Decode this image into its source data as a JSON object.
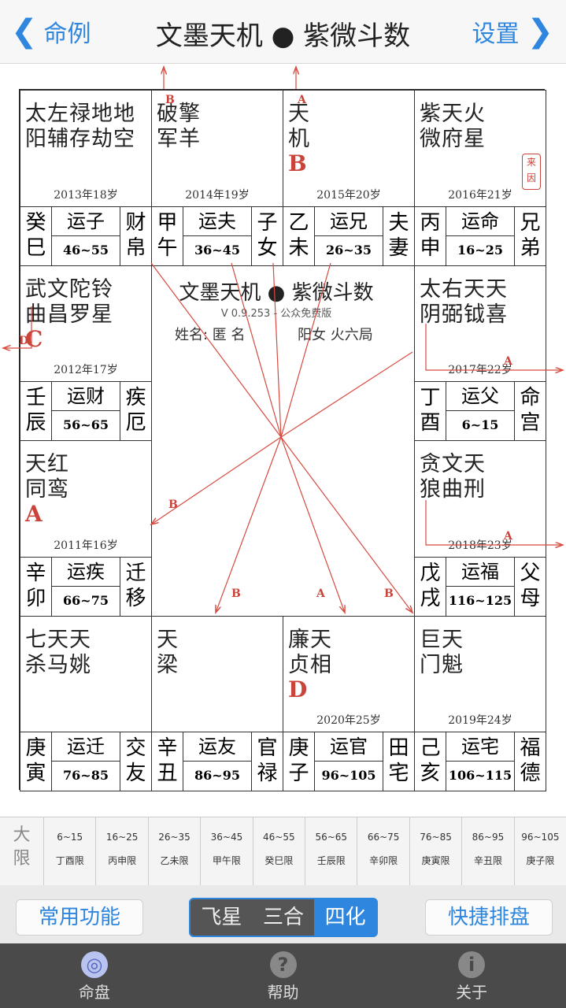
{
  "nav": {
    "back_label": "命例",
    "title": "文墨天机 ● 紫微斗数",
    "settings_label": "设置"
  },
  "palaces": [
    {
      "stars1": "太左禄地地",
      "stars2": "阳辅存劫空",
      "sihua": "",
      "age": "2013年18岁",
      "stem1": "癸",
      "stem2": "巳",
      "yun": "运子",
      "range": "46~55",
      "pal1": "财",
      "pal2": "帛"
    },
    {
      "stars1": "破擎",
      "stars2": "军羊",
      "sihua": "",
      "age": "2014年19岁",
      "stem1": "甲",
      "stem2": "午",
      "yun": "运夫",
      "range": "36~45",
      "pal1": "子",
      "pal2": "女"
    },
    {
      "stars1": "天",
      "stars2": "机",
      "sihua": "B",
      "age": "2015年20岁",
      "stem1": "乙",
      "stem2": "未",
      "yun": "运兄",
      "range": "26~35",
      "pal1": "夫",
      "pal2": "妻"
    },
    {
      "stars1": "紫天火",
      "stars2": "微府星",
      "sihua": "",
      "age": "2016年21岁",
      "stem1": "丙",
      "stem2": "申",
      "yun": "运命",
      "range": "16~25",
      "pal1": "兄",
      "pal2": "弟",
      "stamp": "来因"
    },
    {
      "stars1": "武文陀铃",
      "stars2": "曲昌罗星",
      "sihua": "C",
      "age": "2012年17岁",
      "stem1": "壬",
      "stem2": "辰",
      "yun": "运财",
      "range": "56~65",
      "pal1": "疾",
      "pal2": "厄"
    },
    {
      "stars1": "太右天天",
      "stars2": "阴弼钺喜",
      "sihua": "",
      "age": "2017年22岁",
      "stem1": "丁",
      "stem2": "酉",
      "yun": "运父",
      "range": "6~15",
      "pal1": "命",
      "pal2": "宫"
    },
    {
      "stars1": "天红",
      "stars2": "同鸾",
      "sihua": "A",
      "age": "2011年16岁",
      "stem1": "辛",
      "stem2": "卯",
      "yun": "运疾",
      "range": "66~75",
      "pal1": "迁",
      "pal2": "移"
    },
    {
      "stars1": "贪文天",
      "stars2": "狼曲刑",
      "sihua": "",
      "age": "2018年23岁",
      "stem1": "戊",
      "stem2": "戌",
      "yun": "运福",
      "range": "116~125",
      "pal1": "父",
      "pal2": "母"
    },
    {
      "stars1": "七天天",
      "stars2": "杀马姚",
      "sihua": "",
      "age": "",
      "stem1": "庚",
      "stem2": "寅",
      "yun": "运迁",
      "range": "76~85",
      "pal1": "交",
      "pal2": "友"
    },
    {
      "stars1": "天",
      "stars2": "梁",
      "sihua": "",
      "age": "",
      "stem1": "辛",
      "stem2": "丑",
      "yun": "运友",
      "range": "86~95",
      "pal1": "官",
      "pal2": "禄"
    },
    {
      "stars1": "廉天",
      "stars2": "贞相",
      "sihua": "D",
      "age": "2020年25岁",
      "stem1": "庚",
      "stem2": "子",
      "yun": "运官",
      "range": "96~105",
      "pal1": "田",
      "pal2": "宅"
    },
    {
      "stars1": "巨天",
      "stars2": "门魁",
      "sihua": "",
      "age": "2019年24岁",
      "stem1": "己",
      "stem2": "亥",
      "yun": "运宅",
      "range": "106~115",
      "pal1": "福",
      "pal2": "德"
    }
  ],
  "center": {
    "title": "文墨天机 ● 紫微斗数",
    "version": "V 0.9.253 - 公众免费版",
    "name": "姓名: 匿 名",
    "ju": "阳女 火六局"
  },
  "markers": [
    "B",
    "A",
    "D",
    "A",
    "A",
    "B",
    "B",
    "A",
    "B"
  ],
  "daxian": {
    "label1": "大",
    "label2": "限",
    "items": [
      {
        "range": "6~15",
        "name": "丁酉限"
      },
      {
        "range": "16~25",
        "name": "丙申限"
      },
      {
        "range": "26~35",
        "name": "乙未限"
      },
      {
        "range": "36~45",
        "name": "甲午限"
      },
      {
        "range": "46~55",
        "name": "癸巳限"
      },
      {
        "range": "56~65",
        "name": "壬辰限"
      },
      {
        "range": "66~75",
        "name": "辛卯限"
      },
      {
        "range": "76~85",
        "name": "庚寅限"
      },
      {
        "range": "86~95",
        "name": "辛丑限"
      },
      {
        "range": "96~105",
        "name": "庚子限"
      }
    ]
  },
  "toolbar": {
    "common_label": "常用功能",
    "seg": [
      "飞星",
      "三合",
      "四化"
    ],
    "active_seg": "四化",
    "quick_label": "快捷排盘"
  },
  "tabs": [
    {
      "label": "命盘",
      "icon": "target-icon"
    },
    {
      "label": "帮助",
      "icon": "question-icon"
    },
    {
      "label": "关于",
      "icon": "info-icon"
    }
  ],
  "colors": {
    "accent": "#2e86de",
    "sihua_red": "#c9443a",
    "tabbar": "#4a4a4a"
  }
}
